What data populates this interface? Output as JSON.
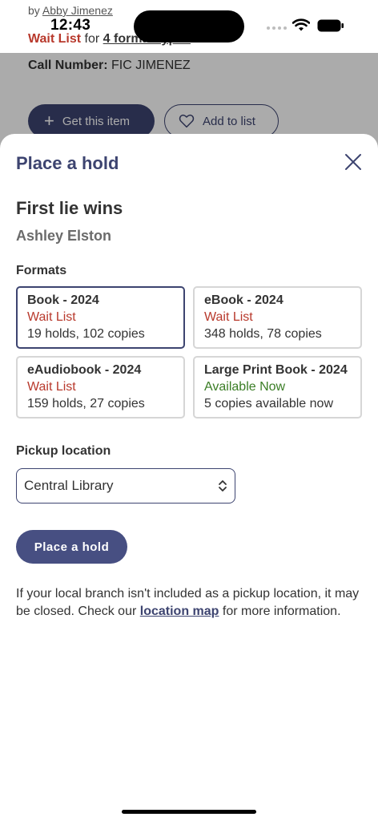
{
  "status_bar": {
    "time": "12:43"
  },
  "background": {
    "author_prefix": "by",
    "author_name": "Abby Jimenez",
    "availability_status": "Wait List",
    "availability_for": "for",
    "availability_types": "4 format types",
    "call_number_label": "Call Number:",
    "call_number_value": "FIC JIMENEZ",
    "get_item_label": "Get this item",
    "add_to_list_label": "Add to list"
  },
  "modal": {
    "title": "Place a hold",
    "book_title": "First lie wins",
    "book_author": "Ashley Elston",
    "formats_label": "Formats",
    "formats": [
      {
        "name": "Book - 2024",
        "status": "Wait List",
        "detail": "19 holds, 102 copies"
      },
      {
        "name": "eBook - 2024",
        "status": "Wait List",
        "detail": "348 holds, 78 copies"
      },
      {
        "name": "eAudiobook - 2024",
        "status": "Wait List",
        "detail": "159 holds, 27 copies"
      },
      {
        "name": "Large Print Book - 2024",
        "status": "Available Now",
        "detail": "5 copies available now"
      }
    ],
    "selected_format": "Book - 2024",
    "pickup_label": "Pickup location",
    "pickup_value": "Central Library",
    "place_hold_label": "Place a hold",
    "info_before": "If your local branch isn't included as a pickup location, it may be closed. Check our",
    "info_link": "location map",
    "info_after": "for more information."
  },
  "colors": {
    "brand": "#3d4470",
    "wait_list": "#b8392c",
    "available": "#3a7d25"
  }
}
